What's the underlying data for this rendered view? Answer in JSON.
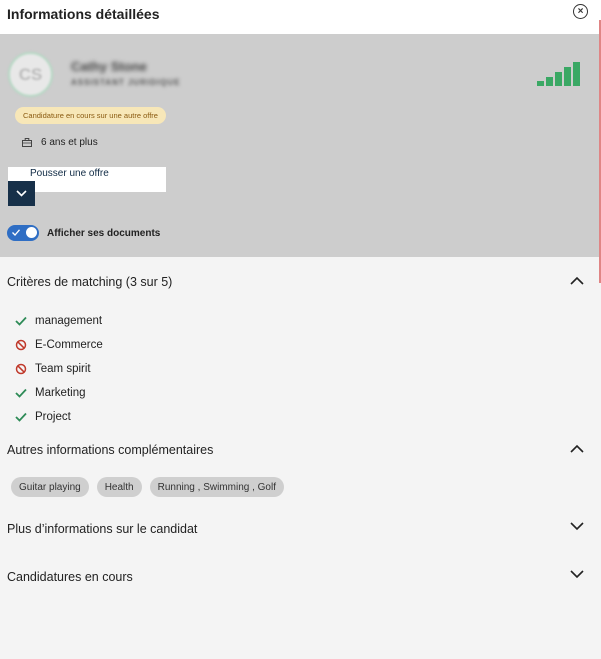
{
  "header": {
    "title": "Informations détaillées",
    "close_symbol": "×"
  },
  "candidate": {
    "initials": "CS",
    "name": "Cathy Stone",
    "role": "ASSISTANT JURIDIQUE",
    "signal_level": "5 of 5 bars",
    "status": "Candidature en cours sur une autre offre",
    "experience": "6 ans et plus",
    "push_offer_label": "Pousser une offre",
    "documents_toggle": {
      "label": "Afficher ses documents",
      "on": true
    }
  },
  "colors": {
    "signal": "#3aa864",
    "match_yes": "#2e8b57",
    "match_no": "#c0392b",
    "status_pill_bg": "#f7e7b8",
    "toggle_active": "#2f6ec4",
    "push_button": "#173049"
  },
  "matching": {
    "title": "Critères de matching (3 sur 5)",
    "expanded": true,
    "criteria": [
      {
        "label": "management",
        "matched": true,
        "icon": "check-icon"
      },
      {
        "label": "E-Commerce",
        "matched": false,
        "icon": "block-icon"
      },
      {
        "label": "Team spirit",
        "matched": false,
        "icon": "block-icon"
      },
      {
        "label": "Marketing",
        "matched": true,
        "icon": "check-icon"
      },
      {
        "label": "Project",
        "matched": true,
        "icon": "check-icon"
      }
    ]
  },
  "additional": {
    "title": "Autres informations complémentaires",
    "expanded": true,
    "tags": [
      "Guitar playing",
      "Health",
      "Running , Swimming , Golf"
    ]
  },
  "more_info": {
    "title": "Plus d’informations sur le candidat",
    "expanded": false
  },
  "applications": {
    "title": "Candidatures en cours",
    "expanded": false
  }
}
